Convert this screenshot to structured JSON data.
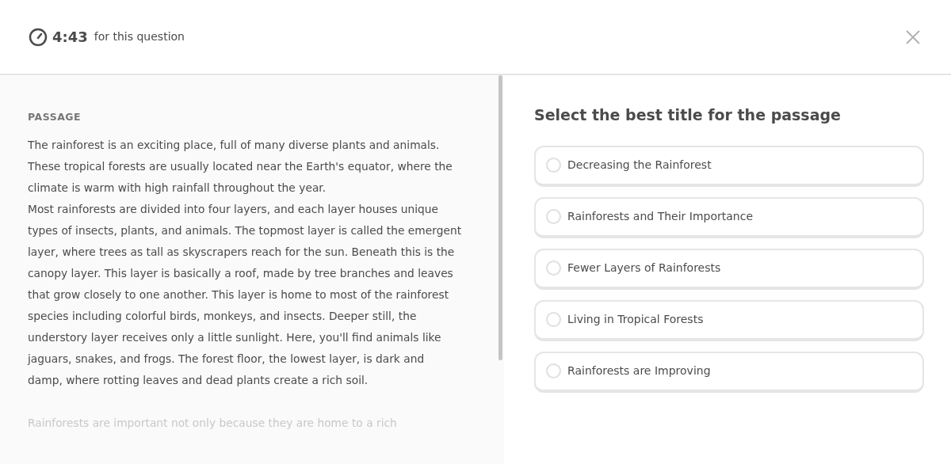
{
  "timer": {
    "time": "4:43",
    "label": "for this question"
  },
  "passage": {
    "heading": "PASSAGE",
    "paragraphs": [
      {
        "text": "The rainforest is an exciting place, full of many diverse plants and animals. These tropical forests are usually located near the Earth's equator, where the climate is warm with high rainfall throughout the year.",
        "faded": false
      },
      {
        "text": "Most rainforests are divided into four layers, and each layer houses unique types of insects, plants, and animals. The topmost layer is called the emergent layer, where trees as tall as skyscrapers reach for the sun. Beneath this is the canopy layer. This layer is basically a roof, made by tree branches and leaves that grow closely to one another. This layer is home to most of the rainforest species including colorful birds, monkeys, and insects. Deeper still, the understory layer receives only a little sunlight. Here, you'll find animals like jaguars, snakes, and frogs. The forest floor, the lowest layer, is dark and damp, where rotting leaves and dead plants create a rich soil.",
        "faded": false
      },
      {
        "text": "Rainforests are important not only because they are home to a rich",
        "faded": true
      }
    ]
  },
  "question": {
    "prompt": "Select the best title for the passage",
    "options": [
      {
        "label": "Decreasing the Rainforest",
        "selected": false
      },
      {
        "label": "Rainforests and Their Importance",
        "selected": false
      },
      {
        "label": "Fewer Layers of Rainforests",
        "selected": false
      },
      {
        "label": "Living in Tropical Forests",
        "selected": false
      },
      {
        "label": "Rainforests are Improving",
        "selected": false
      }
    ]
  }
}
